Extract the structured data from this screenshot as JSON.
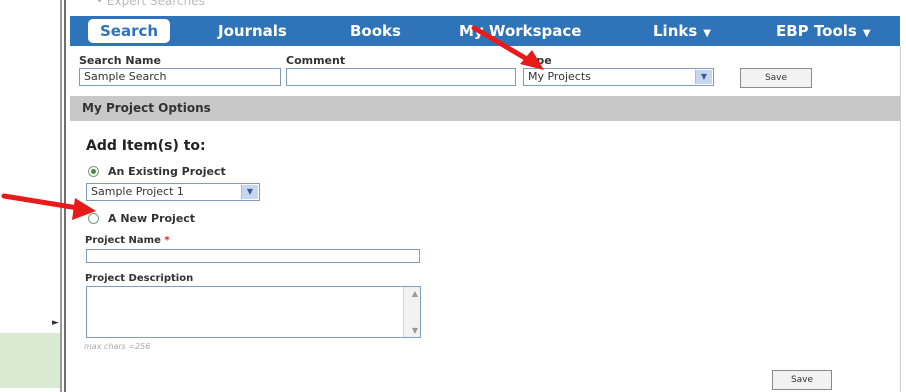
{
  "top_hint": "• Expert Searches",
  "nav": {
    "tabs": [
      {
        "label": "Search",
        "active": true
      },
      {
        "label": "Journals"
      },
      {
        "label": "Books"
      },
      {
        "label": "My Workspace"
      },
      {
        "label": "Links",
        "caret": "▼"
      },
      {
        "label": "EBP Tools",
        "caret": "▼"
      }
    ]
  },
  "save_row": {
    "search_name_label": "Search Name",
    "search_name_value": "Sample Search",
    "comment_label": "Comment",
    "comment_value": "",
    "type_label": "Type",
    "type_value": "My Projects",
    "save_label": "Save"
  },
  "options": {
    "section_title": "My Project Options",
    "heading": "Add Item(s) to:",
    "existing_label": "An Existing Project",
    "existing_selected": "Sample Project 1",
    "new_label": "A New Project",
    "project_name_label": "Project Name",
    "required_mark": "*",
    "project_description_label": "Project Description",
    "max_chars_hint": "max chars =256",
    "save_label": "Save"
  },
  "colors": {
    "nav_bg": "#2f74b8",
    "section_bg": "#c8c8c8",
    "annotation_arrow": "#e81b1b"
  },
  "icons": [
    "chevron-down-icon",
    "radio-checked-icon",
    "radio-unchecked-icon",
    "scroll-up-icon",
    "scroll-down-icon",
    "red-arrow-annotation"
  ]
}
